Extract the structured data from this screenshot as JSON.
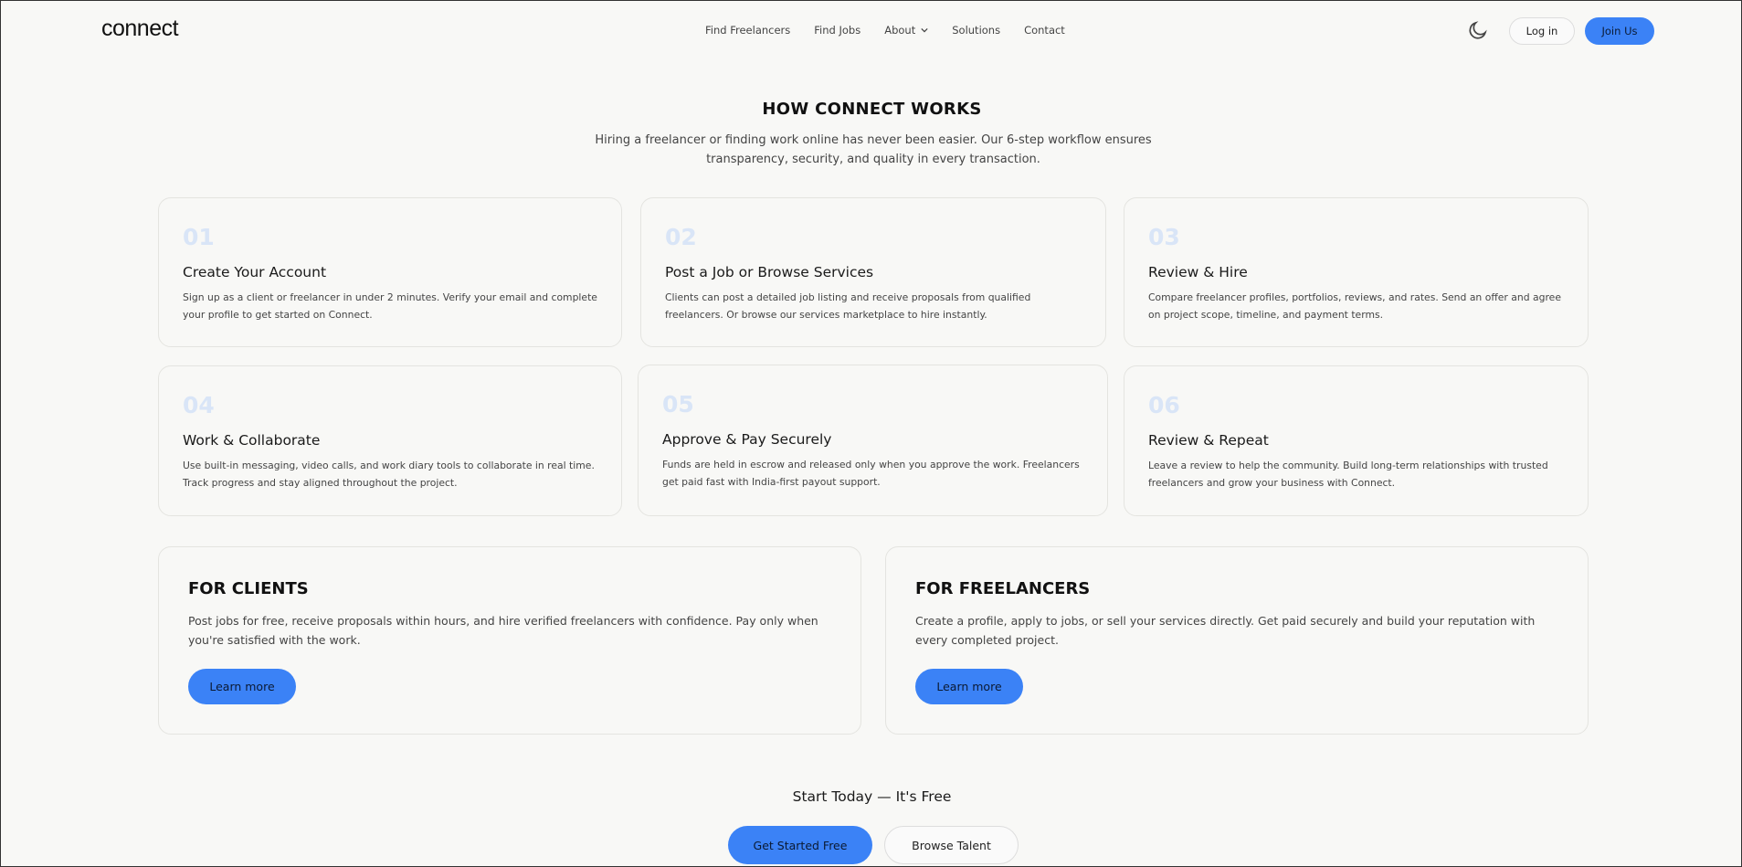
{
  "header": {
    "logo": "connect",
    "nav": [
      "Find Freelancers",
      "Find Jobs",
      "About",
      "Solutions",
      "Contact"
    ],
    "login": "Log in",
    "join": "Join Us",
    "theme_icon": "moon-icon"
  },
  "hero": {
    "title": "HOW CONNECT WORKS",
    "subtitle": "Hiring a freelancer or finding work online has never been easier. Our 6-step workflow ensures transparency, security, and quality in every transaction."
  },
  "steps": [
    {
      "num": "01",
      "title": "Create Your Account",
      "desc": "Sign up as a client or freelancer in under 2 minutes. Verify your email and complete your profile to get started on Connect."
    },
    {
      "num": "02",
      "title": "Post a Job or Browse Services",
      "desc": "Clients can post a detailed job listing and receive proposals from qualified freelancers. Or browse our services marketplace to hire instantly."
    },
    {
      "num": "03",
      "title": "Review & Hire",
      "desc": "Compare freelancer profiles, portfolios, reviews, and rates. Send an offer and agree on project scope, timeline, and payment terms."
    },
    {
      "num": "04",
      "title": "Work & Collaborate",
      "desc": "Use built-in messaging, video calls, and work diary tools to collaborate in real time. Track progress and stay aligned throughout the project."
    },
    {
      "num": "05",
      "title": "Approve & Pay Securely",
      "desc": "Funds are held in escrow and released only when you approve the work. Freelancers get paid fast with India-first payout support."
    },
    {
      "num": "06",
      "title": "Review & Repeat",
      "desc": "Leave a review to help the community. Build long-term relationships with trusted freelancers and grow your business with Connect."
    }
  ],
  "clients": {
    "title": "FOR CLIENTS",
    "desc": "Post jobs for free, receive proposals within hours, and hire verified freelancers with confidence. Pay only when you're satisfied with the work.",
    "button": "Learn more"
  },
  "freelancers": {
    "title": "FOR FREELANCERS",
    "desc": "Create a profile, apply to jobs, or sell your services directly. Get paid securely and build your reputation with every completed project.",
    "button": "Learn more"
  },
  "cta": {
    "title": "Start Today — It's Free",
    "primary": "Get Started Free",
    "secondary": "Browse Talent"
  },
  "colors": {
    "accent": "#3b82f6",
    "step_number": "#d9e5f7",
    "background": "#f8f8f6"
  }
}
